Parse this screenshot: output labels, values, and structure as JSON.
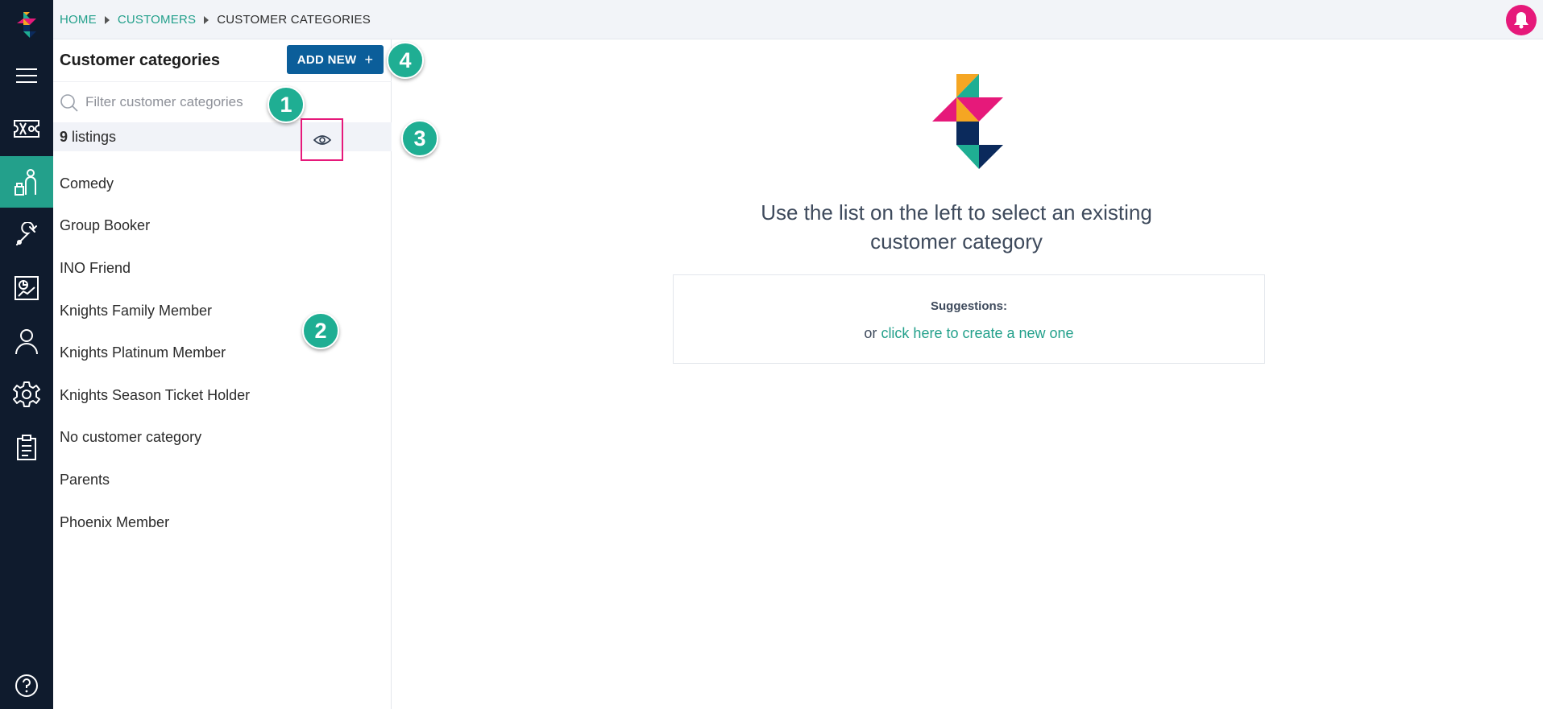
{
  "breadcrumb": {
    "home": "HOME",
    "customers": "CUSTOMERS",
    "current": "CUSTOMER CATEGORIES"
  },
  "panel": {
    "title": "Customer categories",
    "add_button": "ADD NEW",
    "add_button_icon": "+",
    "filter_placeholder": "Filter customer categories",
    "listings_count": "9",
    "listings_label": "listings",
    "items": [
      "Comedy",
      "Group Booker",
      "INO Friend",
      "Knights Family Member",
      "Knights Platinum Member",
      "Knights Season Ticket Holder",
      "No customer category",
      "Parents",
      "Phoenix Member"
    ]
  },
  "callouts": [
    "1",
    "2",
    "3",
    "4"
  ],
  "main": {
    "message": "Use the list on the left to select an existing customer category",
    "suggestions_label": "Suggestions:",
    "or_text": "or",
    "create_link": "click here to create a new one"
  },
  "nav_icons": [
    "menu-icon",
    "ticket-icon",
    "customers-icon",
    "wrench-icon",
    "reports-icon",
    "user-icon",
    "settings-icon",
    "clipboard-icon",
    "help-icon"
  ],
  "colors": {
    "rail": "#0f1b2d",
    "accent": "#23a08b",
    "button": "#0b5e9a",
    "highlight": "#e6197a",
    "callout": "#1fae93"
  }
}
